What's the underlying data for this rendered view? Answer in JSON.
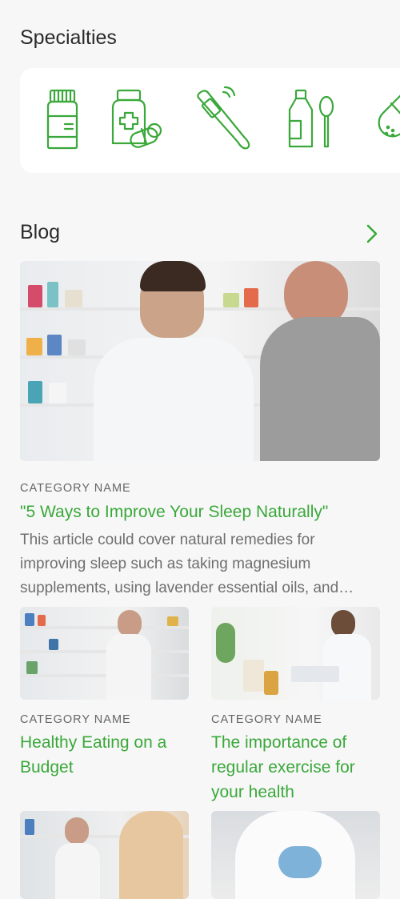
{
  "specialties": {
    "title": "Specialties",
    "items": [
      {
        "icon": "medicine-bottle-icon"
      },
      {
        "icon": "medicine-bottle-pills-icon"
      },
      {
        "icon": "thermometer-icon"
      },
      {
        "icon": "syrup-spoon-icon"
      },
      {
        "icon": "capsule-icon"
      }
    ],
    "accent": "#3aa83a"
  },
  "blog": {
    "title": "Blog",
    "featured": {
      "category": "CATEGORY NAME",
      "title": "\"5 Ways to Improve Your Sleep Naturally\"",
      "excerpt": "This article could cover natural remedies for improving sleep such as taking magnesium supplements, using lavender essential oils, and…"
    },
    "posts": [
      {
        "category": "CATEGORY NAME",
        "title": "Healthy Eating on a Budget"
      },
      {
        "category": "CATEGORY NAME",
        "title": "The importance of regular exercise for your health"
      }
    ]
  }
}
